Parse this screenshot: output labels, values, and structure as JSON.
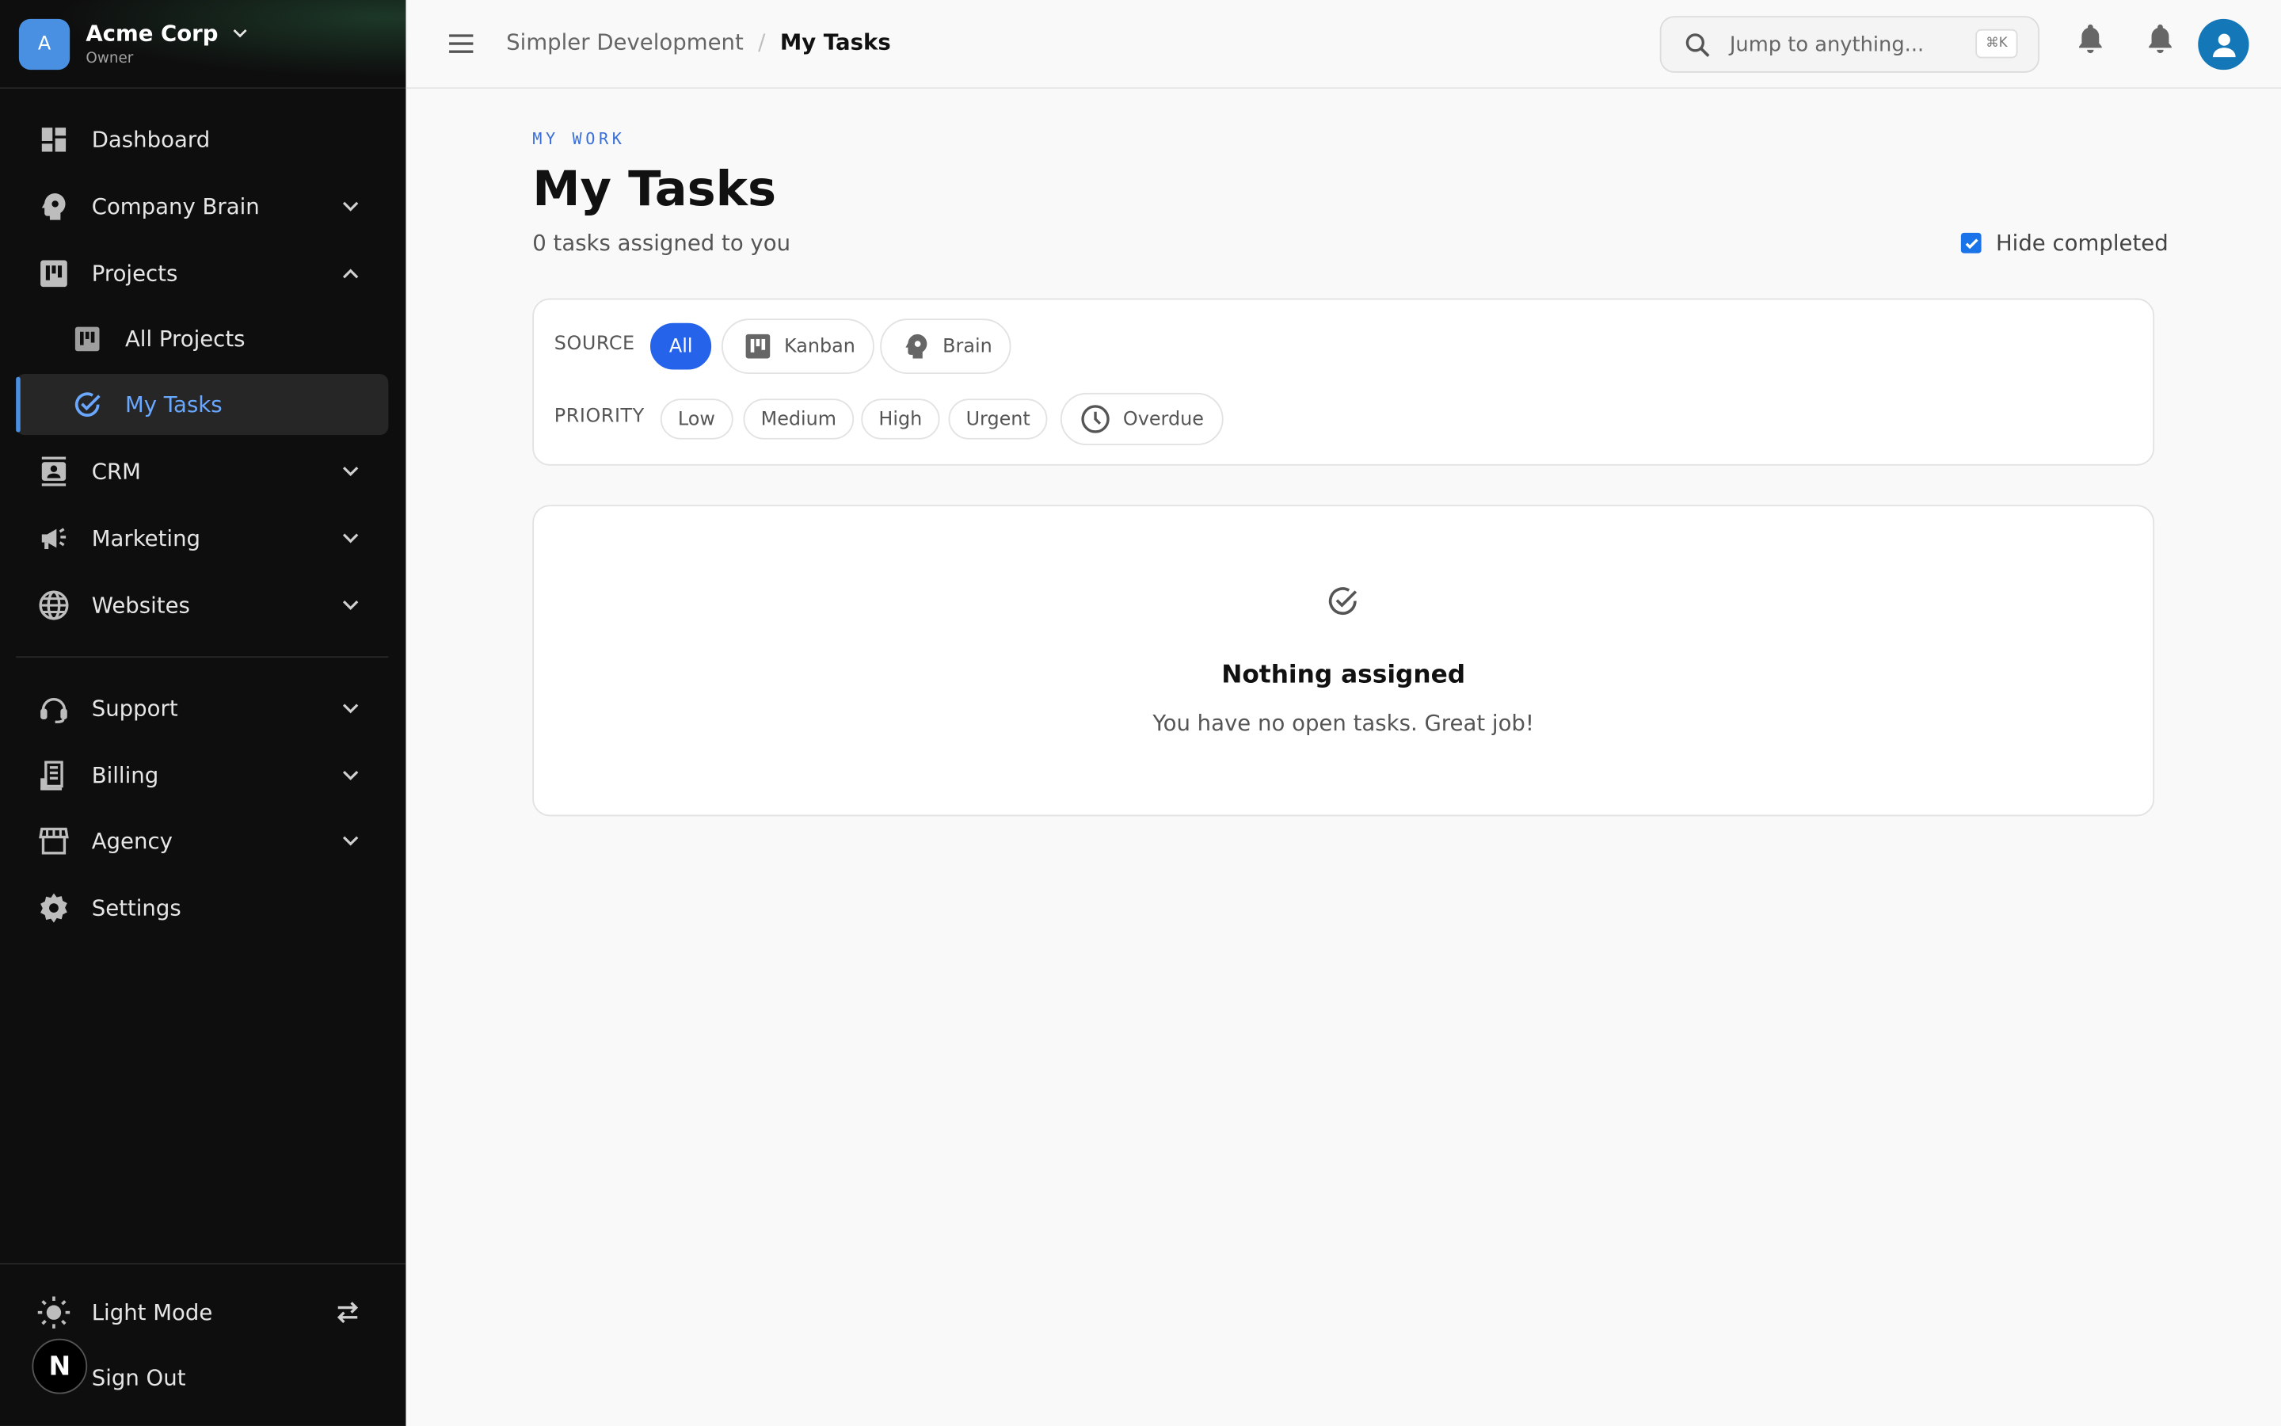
{
  "org": {
    "avatar_letter": "A",
    "name": "Acme Corp",
    "role": "Owner"
  },
  "sidebar": {
    "items": [
      {
        "label": "Dashboard",
        "icon": "dashboard-icon"
      },
      {
        "label": "Company Brain",
        "icon": "brain-icon"
      },
      {
        "label": "Projects",
        "icon": "kanban-icon"
      },
      {
        "label": "All Projects",
        "icon": "kanban-icon"
      },
      {
        "label": "My Tasks",
        "icon": "check-circle-icon"
      },
      {
        "label": "CRM",
        "icon": "contacts-icon"
      },
      {
        "label": "Marketing",
        "icon": "megaphone-icon"
      },
      {
        "label": "Websites",
        "icon": "globe-icon"
      },
      {
        "label": "Support",
        "icon": "headset-icon"
      },
      {
        "label": "Billing",
        "icon": "receipt-icon"
      },
      {
        "label": "Agency",
        "icon": "storefront-icon"
      },
      {
        "label": "Settings",
        "icon": "gear-icon"
      }
    ],
    "light_mode": "Light Mode",
    "sign_out": "Sign Out",
    "badge_letter": "N"
  },
  "topbar": {
    "breadcrumb_parent": "Simpler Development",
    "breadcrumb_separator": "/",
    "breadcrumb_current": "My Tasks",
    "search_placeholder": "Jump to anything...",
    "search_shortcut": "⌘K"
  },
  "page": {
    "eyebrow": "MY WORK",
    "title": "My Tasks",
    "subtitle": "0 tasks assigned to you",
    "hide_completed_label": "Hide completed",
    "hide_completed_checked": true
  },
  "filters": {
    "source_label": "SOURCE",
    "source_options": [
      "All",
      "Kanban",
      "Brain"
    ],
    "source_selected": "All",
    "priority_label": "PRIORITY",
    "priority_options": [
      "Low",
      "Medium",
      "High",
      "Urgent"
    ],
    "overdue_label": "Overdue"
  },
  "empty_state": {
    "title": "Nothing assigned",
    "message": "You have no open tasks. Great job!"
  },
  "colors": {
    "sidebar_bg": "#0e0e0e",
    "accent": "#2563eb",
    "active_text": "#6aa8ff"
  }
}
